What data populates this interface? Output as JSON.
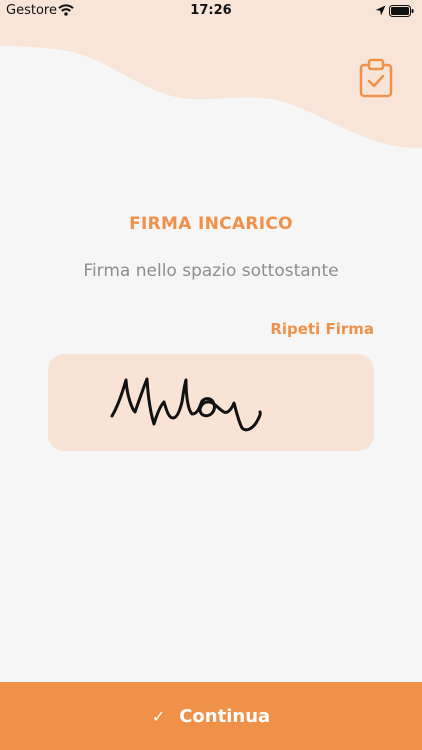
{
  "status_bar": {
    "carrier": "Gestore",
    "time": "17:26"
  },
  "header": {
    "icon": "clipboard-check-icon"
  },
  "content": {
    "title": "FIRMA INCARICO",
    "subtitle": "Firma nello spazio sottostante",
    "repeat_label": "Ripeti Firma"
  },
  "signature": {
    "state": "signed"
  },
  "footer": {
    "continue_label": "Continua",
    "continue_icon": "checkmark-icon"
  },
  "colors": {
    "accent": "#f0914a",
    "wave": "#f8e5d8",
    "pad": "#f8e3d5",
    "background": "#f6f6f6"
  }
}
